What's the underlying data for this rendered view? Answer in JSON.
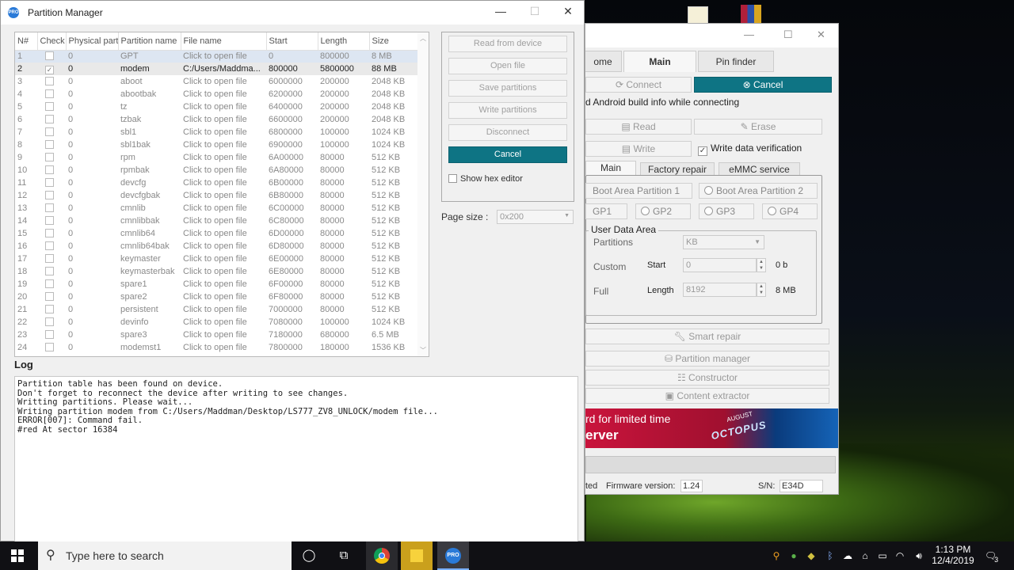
{
  "desktop": {},
  "finder_window": {
    "tabs": [
      {
        "label": "ome"
      },
      {
        "label": "Main"
      },
      {
        "label": "Pin finder"
      }
    ],
    "connect_label": "Connect",
    "cancel_label": "Cancel",
    "android_info": "d Android build info while connecting",
    "read_label": "Read",
    "erase_label": "Erase",
    "write_label": "Write",
    "write_verification": "Write data verification",
    "subtabs": [
      {
        "label": "Main"
      },
      {
        "label": "Factory repair"
      },
      {
        "label": "eMMC service"
      }
    ],
    "boot1": "Boot Area Partition 1",
    "boot2": "Boot Area Partition 2",
    "gp1": "GP1",
    "gp2": "GP2",
    "gp3": "GP3",
    "gp4": "GP4",
    "user_data_area": "User Data Area",
    "partitions": "Partitions",
    "unit_select": "KB",
    "custom": "Custom",
    "start_label": "Start",
    "start_value": "0",
    "start_suffix": "0 b",
    "full": "Full",
    "length_label": "Length",
    "length_value": "8192",
    "length_suffix": "8 MB",
    "smart_repair": "Smart repair",
    "partition_manager": "Partition manager",
    "constructor": "Constructor",
    "content_extractor": "Content extractor",
    "banner_text1": "rd for limited time",
    "banner_text2": "erver",
    "banner_brand": "OCTOPUS",
    "banner_date": "AUGUST",
    "status_left": "ted",
    "firmware_label": "Firmware version:",
    "firmware_value": "1.24",
    "sn_label": "S/N:",
    "sn_value": "E34D"
  },
  "partition_window": {
    "title": "Partition Manager",
    "app_icon_text": "PRO",
    "columns": [
      "N#",
      "Check",
      "Physical part",
      "Partition name",
      "File name",
      "Start",
      "Length",
      "Size"
    ],
    "rows": [
      {
        "n": "1",
        "checked": false,
        "phys": "0",
        "name": "GPT",
        "file": "Click to open file",
        "start": "0",
        "length": "800000",
        "size": "8 MB",
        "state": "sel"
      },
      {
        "n": "2",
        "checked": true,
        "phys": "0",
        "name": "modem",
        "file": "C:/Users/Maddma...",
        "start": "800000",
        "length": "5800000",
        "size": "88 MB",
        "state": "hl"
      },
      {
        "n": "3",
        "checked": false,
        "phys": "0",
        "name": "aboot",
        "file": "Click to open file",
        "start": "6000000",
        "length": "200000",
        "size": "2048 KB",
        "state": ""
      },
      {
        "n": "4",
        "checked": false,
        "phys": "0",
        "name": "abootbak",
        "file": "Click to open file",
        "start": "6200000",
        "length": "200000",
        "size": "2048 KB",
        "state": ""
      },
      {
        "n": "5",
        "checked": false,
        "phys": "0",
        "name": "tz",
        "file": "Click to open file",
        "start": "6400000",
        "length": "200000",
        "size": "2048 KB",
        "state": ""
      },
      {
        "n": "6",
        "checked": false,
        "phys": "0",
        "name": "tzbak",
        "file": "Click to open file",
        "start": "6600000",
        "length": "200000",
        "size": "2048 KB",
        "state": ""
      },
      {
        "n": "7",
        "checked": false,
        "phys": "0",
        "name": "sbl1",
        "file": "Click to open file",
        "start": "6800000",
        "length": "100000",
        "size": "1024 KB",
        "state": ""
      },
      {
        "n": "8",
        "checked": false,
        "phys": "0",
        "name": "sbl1bak",
        "file": "Click to open file",
        "start": "6900000",
        "length": "100000",
        "size": "1024 KB",
        "state": ""
      },
      {
        "n": "9",
        "checked": false,
        "phys": "0",
        "name": "rpm",
        "file": "Click to open file",
        "start": "6A00000",
        "length": "80000",
        "size": "512 KB",
        "state": ""
      },
      {
        "n": "10",
        "checked": false,
        "phys": "0",
        "name": "rpmbak",
        "file": "Click to open file",
        "start": "6A80000",
        "length": "80000",
        "size": "512 KB",
        "state": ""
      },
      {
        "n": "11",
        "checked": false,
        "phys": "0",
        "name": "devcfg",
        "file": "Click to open file",
        "start": "6B00000",
        "length": "80000",
        "size": "512 KB",
        "state": ""
      },
      {
        "n": "12",
        "checked": false,
        "phys": "0",
        "name": "devcfgbak",
        "file": "Click to open file",
        "start": "6B80000",
        "length": "80000",
        "size": "512 KB",
        "state": ""
      },
      {
        "n": "13",
        "checked": false,
        "phys": "0",
        "name": "cmnlib",
        "file": "Click to open file",
        "start": "6C00000",
        "length": "80000",
        "size": "512 KB",
        "state": ""
      },
      {
        "n": "14",
        "checked": false,
        "phys": "0",
        "name": "cmnlibbak",
        "file": "Click to open file",
        "start": "6C80000",
        "length": "80000",
        "size": "512 KB",
        "state": ""
      },
      {
        "n": "15",
        "checked": false,
        "phys": "0",
        "name": "cmnlib64",
        "file": "Click to open file",
        "start": "6D00000",
        "length": "80000",
        "size": "512 KB",
        "state": ""
      },
      {
        "n": "16",
        "checked": false,
        "phys": "0",
        "name": "cmnlib64bak",
        "file": "Click to open file",
        "start": "6D80000",
        "length": "80000",
        "size": "512 KB",
        "state": ""
      },
      {
        "n": "17",
        "checked": false,
        "phys": "0",
        "name": "keymaster",
        "file": "Click to open file",
        "start": "6E00000",
        "length": "80000",
        "size": "512 KB",
        "state": ""
      },
      {
        "n": "18",
        "checked": false,
        "phys": "0",
        "name": "keymasterbak",
        "file": "Click to open file",
        "start": "6E80000",
        "length": "80000",
        "size": "512 KB",
        "state": ""
      },
      {
        "n": "19",
        "checked": false,
        "phys": "0",
        "name": "spare1",
        "file": "Click to open file",
        "start": "6F00000",
        "length": "80000",
        "size": "512 KB",
        "state": ""
      },
      {
        "n": "20",
        "checked": false,
        "phys": "0",
        "name": "spare2",
        "file": "Click to open file",
        "start": "6F80000",
        "length": "80000",
        "size": "512 KB",
        "state": ""
      },
      {
        "n": "21",
        "checked": false,
        "phys": "0",
        "name": "persistent",
        "file": "Click to open file",
        "start": "7000000",
        "length": "80000",
        "size": "512 KB",
        "state": ""
      },
      {
        "n": "22",
        "checked": false,
        "phys": "0",
        "name": "devinfo",
        "file": "Click to open file",
        "start": "7080000",
        "length": "100000",
        "size": "1024 KB",
        "state": ""
      },
      {
        "n": "23",
        "checked": false,
        "phys": "0",
        "name": "spare3",
        "file": "Click to open file",
        "start": "7180000",
        "length": "680000",
        "size": "6.5 MB",
        "state": ""
      },
      {
        "n": "24",
        "checked": false,
        "phys": "0",
        "name": "modemst1",
        "file": "Click to open file",
        "start": "7800000",
        "length": "180000",
        "size": "1536 KB",
        "state": ""
      }
    ],
    "buttons": {
      "read_from_device": "Read from device",
      "open_file": "Open file",
      "save_partitions": "Save partitions",
      "write_partitions": "Write partitions",
      "disconnect": "Disconnect",
      "cancel": "Cancel"
    },
    "show_hex_editor": "Show hex editor",
    "page_size_label": "Page size :",
    "page_size_value": "0x200",
    "log_label": "Log",
    "log_lines": [
      "Partition table has been found on device.",
      "Don't forget to reconnect the device after writing to see changes.",
      "Writting partitions. Please wait...",
      "Writing partition modem from C:/Users/Maddman/Desktop/LS777_ZV8_UNLOCK/modem file...",
      "ERROR[007]: Command fail.",
      "#red At sector 16384"
    ]
  },
  "taskbar": {
    "search_placeholder": "Type here to search",
    "time": "1:13 PM",
    "date": "12/4/2019",
    "notification_count": "3",
    "app_badge": "PRO"
  }
}
